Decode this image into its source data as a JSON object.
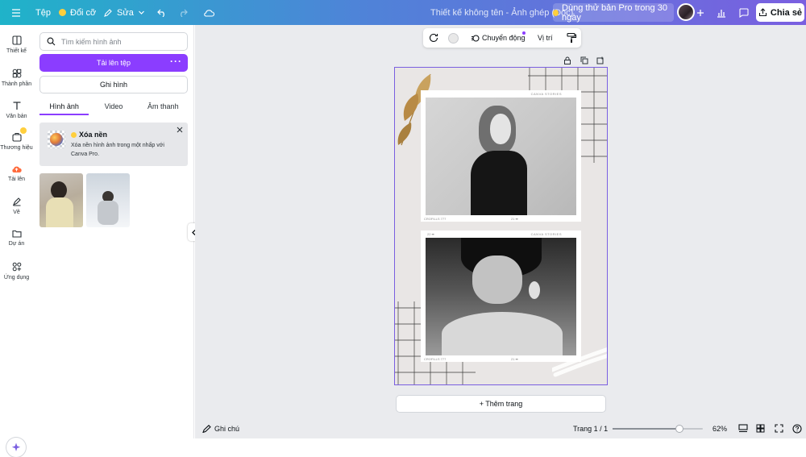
{
  "topbar": {
    "menu_icon": "hamburger-menu-icon",
    "file": "Tệp",
    "resize": "Đổi cỡ",
    "edit": "Sửa",
    "doc_title": "Thiết kế không tên - Ảnh ghép (Doc)",
    "pro_trial": "Dùng thử bản Pro trong 30 ngày",
    "share": "Chia sẻ"
  },
  "rail": [
    {
      "label": "Thiết kế",
      "icon": "layout-icon"
    },
    {
      "label": "Thành phần",
      "icon": "shapes-icon"
    },
    {
      "label": "Văn bản",
      "icon": "text-icon"
    },
    {
      "label": "Thương hiệu",
      "icon": "brand-icon"
    },
    {
      "label": "Tải lên",
      "icon": "upload-cloud-icon"
    },
    {
      "label": "Vẽ",
      "icon": "draw-pen-icon"
    },
    {
      "label": "Dự án",
      "icon": "folder-icon"
    },
    {
      "label": "Ứng dụng",
      "icon": "apps-grid-icon"
    }
  ],
  "panel": {
    "search_placeholder": "Tìm kiếm hình ảnh",
    "upload_label": "Tải lên tệp",
    "record_label": "Ghi hình",
    "tabs": [
      "Hình ảnh",
      "Video",
      "Âm thanh"
    ],
    "promo_title": "Xóa nền",
    "promo_text": "Xóa nền hình ảnh trong một nhấp với Canva Pro."
  },
  "toolbar": {
    "animate": "Chuyển động",
    "position": "Vị trí"
  },
  "canvas": {
    "frame_caption_1": "CANVA STORIES",
    "frame_caption_2": "CANVA STORIES",
    "frame_footer_left": "CROFILLS 777",
    "frame_footer_right": "21 ➡",
    "frame_top_left_2": "22 ➡",
    "add_page": "+ Thêm trang"
  },
  "bottombar": {
    "notes": "Ghi chú",
    "page_indicator": "Trang 1 / 1",
    "zoom": "62%",
    "zoom_level": 0.62
  },
  "colors": {
    "brand_purple": "#8b3dff",
    "selection": "#7a5fe0",
    "gradient_start": "#1fb3c9",
    "gradient_end": "#7a5fe0"
  }
}
